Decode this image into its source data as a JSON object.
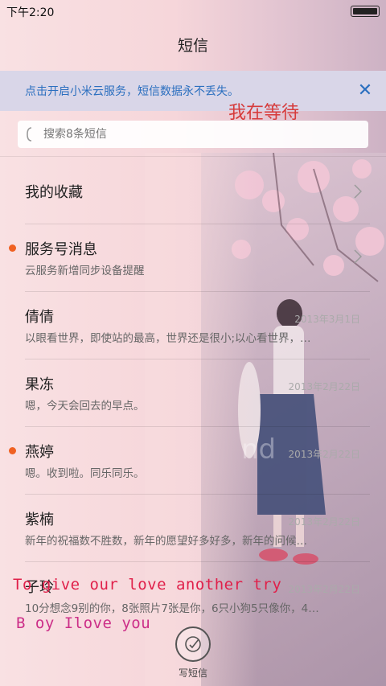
{
  "status": {
    "time": "下午2:20"
  },
  "header": {
    "title": "短信"
  },
  "banner": {
    "text": "点击开启小米云服务，短信数据永不丢失。",
    "close": "✕"
  },
  "search": {
    "placeholder": "搜索8条短信"
  },
  "conversations": [
    {
      "name": "我的收藏",
      "preview": "",
      "date": "",
      "unread": false
    },
    {
      "name": "服务号消息",
      "preview": "云服务新增同步设备提醒",
      "date": "",
      "unread": true
    },
    {
      "name": "倩倩",
      "preview": "以眼看世界，即使站的最高，世界还是很小;以心看世界，…",
      "date": "2013年3月1日",
      "unread": false
    },
    {
      "name": "果冻",
      "preview": "嗯，今天会回去的早点。",
      "date": "2013年2月22日",
      "unread": false
    },
    {
      "name": "燕婷",
      "preview": "嗯。收到啦。同乐同乐。",
      "date": "2013年2月22日",
      "unread": true
    },
    {
      "name": "紫楠",
      "preview": "新年的祝福数不胜数，新年的愿望好多好多，新年的问候…",
      "date": "2013年2月22日",
      "unread": false
    },
    {
      "name": "子玲",
      "preview": "10分想念9别的你，8张照片7张是你，6只小狗5只像你，4…",
      "date": "2013年2月22日",
      "unread": false
    }
  ],
  "overlays": {
    "line1": "我在等待",
    "line2": "To give our love another try",
    "line3": "B oy Ilove you"
  },
  "compose": {
    "label": "写短信"
  },
  "colors": {
    "accent": "#2b6fbf",
    "unread": "#f06122",
    "background": "#f7dadd"
  }
}
